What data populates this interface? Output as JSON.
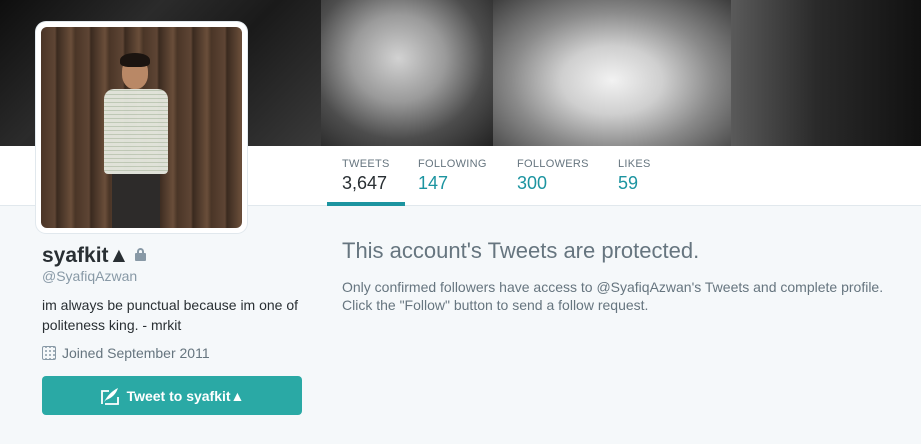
{
  "profile": {
    "name": "syafkit▲",
    "handle": "@SyafiqAzwan",
    "bio": "im always be punctual because im one of politeness king. - mrkit",
    "joined": "Joined September 2011"
  },
  "nav": {
    "stats": [
      {
        "label": "TWEETS",
        "value": "3,647"
      },
      {
        "label": "FOLLOWING",
        "value": "147"
      },
      {
        "label": "FOLLOWERS",
        "value": "300"
      },
      {
        "label": "LIKES",
        "value": "59"
      }
    ]
  },
  "protected": {
    "title": "This account's Tweets are protected.",
    "text": "Only confirmed followers have access to @SyafiqAzwan's Tweets and complete profile. Click the \"Follow\" button to send a follow request."
  },
  "actions": {
    "tweet_to_label": "Tweet to syafkit▲"
  },
  "colors": {
    "accent": "#1c94a0",
    "button": "#2aa9a5",
    "background": "#f5f8fa"
  },
  "icons": [
    "lock-icon",
    "calendar-icon",
    "quill-icon"
  ]
}
